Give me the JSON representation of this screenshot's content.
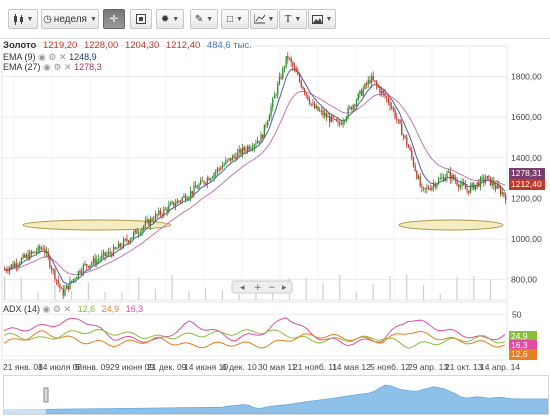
{
  "toolbar": {
    "chart_type_icon": "candlestick-icon",
    "period_label": "неделя",
    "crosshair_icon": "crosshair-icon",
    "scale_icon": "scale-icon",
    "lighting_icon": "lightbulb-icon",
    "draw_icon": "pencil-icon",
    "shape_icon": "rectangle-icon",
    "indicator_icon": "indicator-icon",
    "text_icon": "T",
    "image_icon": "image-icon"
  },
  "instrument": {
    "name": "Золото",
    "open": "1219,20",
    "high": "1228,00",
    "low": "1204,30",
    "close": "1212,40",
    "volume": "484,6 тыс."
  },
  "ema9": {
    "label": "EMA (9)",
    "value": "1248,9"
  },
  "ema27": {
    "label": "EMA (27)",
    "value": "1278,3"
  },
  "price_axis": {
    "labels": [
      "1800,00",
      "1600,00",
      "1400,00",
      "1200,00",
      "1000,00",
      "800,00"
    ]
  },
  "price_tags": {
    "ema27": "1278,31",
    "close": "1212,40"
  },
  "adx": {
    "label": "ADX (14)",
    "v1": "12,6",
    "v2": "24,9",
    "v3": "16,3"
  },
  "adx_axis": {
    "labels": [
      "50",
      "0"
    ]
  },
  "adx_tags": {
    "t1": "24,9",
    "t2": "16,3",
    "t3": "12,6"
  },
  "x_labels": [
    "21 янв. 08",
    "14 июля 08",
    "5 янв. 09",
    "29 июня 09",
    "21 дек. 09",
    "14 июня 10",
    "6 дек. 10",
    "30 мая 11",
    "21 нояб. 11",
    "14 мая 12",
    "5 нояб. 12",
    "29 апр. 13",
    "21 окт. 13",
    "14 апр. 14"
  ],
  "colors": {
    "bull": "#2e8b2e",
    "bear": "#c0392b",
    "ema9": "#4d5fa8",
    "ema27": "#c07ab0",
    "ellipse_fill": "#f5edc2",
    "ellipse_stroke": "#b39a4a",
    "adx_green": "#8bbf3a",
    "adx_orange": "#e67e22",
    "adx_pink": "#e34c9e",
    "nav_fill": "#8ec1ea"
  },
  "chart_data": {
    "type": "candlestick",
    "title": "Золото",
    "period": "неделя",
    "x_range": [
      "2008-01",
      "2014-07"
    ],
    "ylim": [
      700,
      1950
    ],
    "price_series": {
      "x": [
        "2008-01",
        "2008-07",
        "2008-10",
        "2009-01",
        "2009-06",
        "2009-12",
        "2010-06",
        "2010-12",
        "2011-05",
        "2011-09",
        "2012-01",
        "2012-05",
        "2012-10",
        "2013-01",
        "2013-04",
        "2013-06",
        "2013-10",
        "2014-01",
        "2014-04",
        "2014-07"
      ],
      "close": [
        850,
        960,
        730,
        860,
        940,
        1100,
        1230,
        1390,
        1500,
        1900,
        1650,
        1560,
        1790,
        1670,
        1440,
        1230,
        1320,
        1240,
        1300,
        1212
      ]
    },
    "ema27_end": 1278.31,
    "close_end": 1212.4,
    "adx": {
      "x": [
        "2008-01",
        "2008-07",
        "2009-01",
        "2009-06",
        "2010-01",
        "2010-06",
        "2011-01",
        "2011-06",
        "2011-09",
        "2012-01",
        "2012-06",
        "2012-12",
        "2013-04",
        "2013-10",
        "2014-04",
        "2014-07"
      ],
      "adx": [
        30,
        35,
        45,
        22,
        18,
        40,
        20,
        30,
        48,
        25,
        15,
        20,
        45,
        30,
        20,
        24.9
      ],
      "plus_di": [
        25,
        20,
        30,
        28,
        22,
        25,
        28,
        30,
        26,
        18,
        20,
        22,
        12,
        18,
        22,
        16.3
      ],
      "minus_di": [
        15,
        28,
        18,
        14,
        20,
        12,
        15,
        12,
        20,
        25,
        22,
        18,
        30,
        20,
        15,
        12.6
      ]
    }
  }
}
